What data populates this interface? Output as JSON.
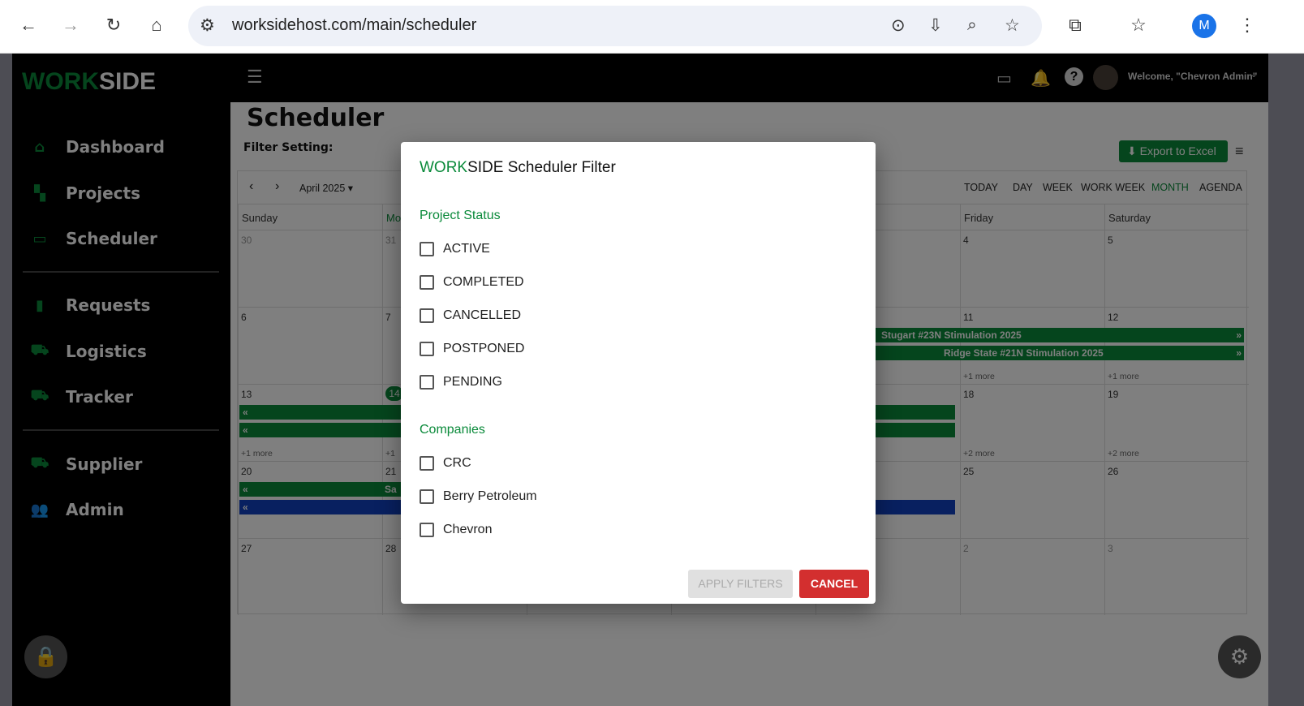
{
  "browser": {
    "url": "worksidehost.com/main/scheduler",
    "profile_initial": "M"
  },
  "app": {
    "logo_a": "WORK",
    "logo_b": "SIDE",
    "welcome": "Welcome, \"Chevron Admin\""
  },
  "sidebar": {
    "items": [
      {
        "label": "Dashboard",
        "icon": "home-icon"
      },
      {
        "label": "Projects",
        "icon": "hierarchy-icon"
      },
      {
        "label": "Scheduler",
        "icon": "calendar-icon"
      },
      {
        "label": "Requests",
        "icon": "document-icon"
      },
      {
        "label": "Logistics",
        "icon": "truck-icon"
      },
      {
        "label": "Tracker",
        "icon": "truck-icon"
      },
      {
        "label": "Supplier",
        "icon": "truck-icon"
      },
      {
        "label": "Admin",
        "icon": "users-icon"
      }
    ]
  },
  "page": {
    "title": "Scheduler",
    "filter_setting": "Filter Setting:",
    "export": "Export to Excel"
  },
  "calendar": {
    "month": "April 2025",
    "views": [
      "TODAY",
      "DAY",
      "WEEK",
      "WORK WEEK",
      "MONTH",
      "AGENDA"
    ],
    "active_view": "MONTH",
    "days": [
      "Sunday",
      "Mo",
      "",
      "",
      "",
      "Friday",
      "Saturday"
    ],
    "weeks": [
      [
        "30",
        "31",
        "",
        "",
        "",
        "4",
        "5"
      ],
      [
        "6",
        "7",
        "",
        "",
        "",
        "11",
        "12"
      ],
      [
        "13",
        "14",
        "",
        "",
        "",
        "18",
        "19"
      ],
      [
        "20",
        "21",
        "",
        "",
        "",
        "25",
        "26"
      ],
      [
        "27",
        "28",
        "",
        "",
        "",
        "2",
        "3"
      ]
    ],
    "more": {
      "w1_fri": "+1 more",
      "w1_sat": "+1 more",
      "w2_sun": "+1 more",
      "w2_mon": "+1",
      "w2_fri": "+2 more",
      "w2_sat": "+2 more"
    },
    "events": {
      "e1": "Stugart #23N Stimulation 2025",
      "e2": "Ridge State #21N Stimulation 2025",
      "e3": "Sa",
      "cont": "«",
      "next": "»"
    }
  },
  "dialog": {
    "title_a": "WORK",
    "title_b": "SIDE Scheduler Filter",
    "status_label": "Project Status",
    "statuses": [
      "ACTIVE",
      "COMPLETED",
      "CANCELLED",
      "POSTPONED",
      "PENDING"
    ],
    "companies_label": "Companies",
    "companies": [
      "CRC",
      "Berry Petroleum",
      "Chevron"
    ],
    "apply": "APPLY FILTERS",
    "cancel": "CANCEL"
  },
  "colors": {
    "brand": "#0a8a3a",
    "event_green": "#0a8a3a",
    "event_blue": "#1040c0",
    "cancel": "#d32f2f"
  }
}
